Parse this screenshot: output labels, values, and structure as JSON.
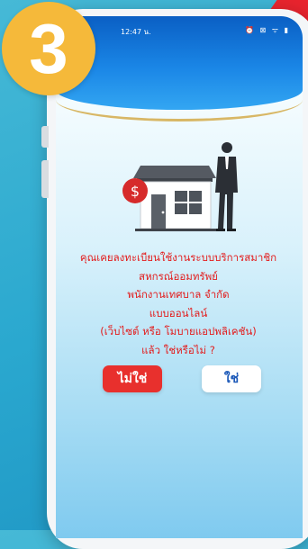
{
  "step_badge": {
    "number": "3"
  },
  "status_bar": {
    "time": "12:47 น.",
    "icons": "⏰ ⊠ ᯤ ▮"
  },
  "illustration": {
    "icon": "house-businessman-dollar-icon",
    "dollar_symbol": "$"
  },
  "question": {
    "lines": [
      "คุณเคยลงทะเบียนใช้งานระบบบริการสมาชิก",
      "สหกรณ์ออมทรัพย์",
      "พนักงานเทศบาล จำกัด",
      "แบบออนไลน์",
      "(เว็บไซต์ หรือ โมบายแอปพลิเคชัน)",
      "แล้ว ใช่หรือไม่ ?"
    ]
  },
  "buttons": {
    "no_label": "ไม่ใช่",
    "yes_label": "ใช่"
  },
  "colors": {
    "header_blue": "#1a86e6",
    "accent_red": "#e8302d",
    "question_text": "#e31c1c",
    "yes_text": "#1b58b8",
    "badge": "#f5b93a",
    "gold_line": "#d8b765"
  }
}
